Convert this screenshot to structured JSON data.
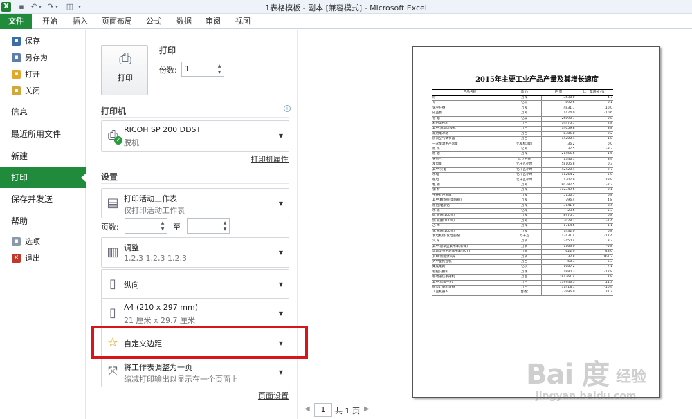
{
  "window": {
    "title": "1表格模板 - 副本  [兼容模式]  -  Microsoft Excel"
  },
  "qat": {
    "logo_glyph": "X",
    "save_glyph": "▪",
    "undo_glyph": "↶",
    "redo_glyph": "↷",
    "dropdown_glyph": "▾",
    "preview_glyph": "◫",
    "customize_glyph": "▾"
  },
  "ribbon_tabs": [
    "文件",
    "开始",
    "插入",
    "页面布局",
    "公式",
    "数据",
    "审阅",
    "视图"
  ],
  "backstage_nav": {
    "commands": [
      {
        "label": "保存",
        "icon": "save-icon",
        "glyph": "▪"
      },
      {
        "label": "另存为",
        "icon": "save-as-icon",
        "glyph": "▪"
      },
      {
        "label": "打开",
        "icon": "open-folder-icon",
        "glyph": "▪"
      },
      {
        "label": "关闭",
        "icon": "close-folder-icon",
        "glyph": "▪"
      }
    ],
    "sections": [
      "信息",
      "最近所用文件",
      "新建",
      "打印",
      "保存并发送",
      "帮助"
    ],
    "bottom": [
      {
        "label": "选项",
        "icon": "options-icon",
        "glyph": "▪"
      },
      {
        "label": "退出",
        "icon": "exit-icon",
        "glyph": "✕"
      }
    ],
    "active": "打印"
  },
  "print": {
    "button_label": "打印",
    "header": "打印",
    "copies_label": "份数:",
    "copies_value": "1",
    "printer_section": "打印机",
    "printer_name": "RICOH SP 200 DDST",
    "printer_status": "脱机",
    "printer_properties": "打印机属性",
    "settings_section": "设置",
    "scope_title": "打印活动工作表",
    "scope_sub": "仅打印活动工作表",
    "pages_label": "页数:",
    "pages_to": "至",
    "collate_title": "调整",
    "collate_sub": "1,2,3    1,2,3    1,2,3",
    "orientation": "纵向",
    "paper_title": "A4 (210 x 297 mm)",
    "paper_sub": "21 厘米 x 29.7 厘米",
    "margins": "自定义边距",
    "scale_title": "将工作表调整为一页",
    "scale_sub": "缩减打印输出以显示在一个页面上",
    "page_setup": "页面设置",
    "info_glyph": "i",
    "spin_up": "▲",
    "spin_down": "▼",
    "caret": "▼",
    "check_glyph": "✓"
  },
  "preview": {
    "title": "2015年主要工业产品产量及其增长速度",
    "columns": [
      "产品名称",
      "单 位",
      "产 量",
      "比上年增长 (%)"
    ],
    "rows": [
      [
        "纱",
        "万吨",
        "3538.0",
        "4.7"
      ],
      [
        "布",
        "亿米",
        "892.6",
        "-0.1"
      ],
      [
        "化学纤维",
        "万吨",
        "4831.7",
        "10.0"
      ],
      [
        "成品糖",
        "万吨",
        "1474.0",
        "-10.6"
      ],
      [
        "卷 烟",
        "亿支",
        "25890.7",
        "-0.8"
      ],
      [
        "彩色电视机",
        "万台",
        "14475.7",
        "2.8"
      ],
      [
        "  其中:液晶电视机",
        "万台",
        "14059.8",
        "3.8"
      ],
      [
        "家用电冰箱",
        "万台",
        "8385.8",
        "-9.2"
      ],
      [
        "房间空气调节器",
        "万台",
        "14200.4",
        "-1.8"
      ],
      [
        "一次能源生产总量",
        "亿吨标准煤",
        "36.2",
        "0.0"
      ],
      [
        "原 煤",
        "亿吨",
        "37.5",
        "-3.3"
      ],
      [
        "原 油",
        "万吨",
        "21455.6",
        "1.5"
      ],
      [
        "天然气",
        "亿立方米",
        "1346.1",
        "3.4"
      ],
      [
        "发电量",
        "亿千瓦小时",
        "58105.8",
        "0.3"
      ],
      [
        "  其中:火电",
        "亿千瓦小时",
        "42420.4",
        "-2.7"
      ],
      [
        "    水电",
        "亿千瓦小时",
        "11264.2",
        "5.0"
      ],
      [
        "    核电",
        "亿千瓦小时",
        "1707.9",
        "28.9"
      ],
      [
        "粗 钢",
        "万吨",
        "80382.5",
        "-2.2"
      ],
      [
        "钢 材",
        "万吨",
        "112349.6",
        "0.1"
      ],
      [
        "十种有色金属",
        "万吨",
        "5156.5",
        "6.8"
      ],
      [
        "  其中:精炼铜(电解铜)",
        "万吨",
        "796.4",
        "4.8"
      ],
      [
        "  原铝(电解铝)",
        "万吨",
        "3141.0",
        "8.4"
      ],
      [
        "水 泥",
        "亿吨",
        "23.6",
        "-5.3"
      ],
      [
        "硫 酸(折100%)",
        "万吨",
        "8975.7",
        "0.8"
      ],
      [
        "烧 碱(折100%)",
        "万吨",
        "3028.1",
        "-1.4"
      ],
      [
        "乙 烯",
        "万吨",
        "1714.6",
        "1.1"
      ],
      [
        "化 肥(折100%)",
        "万吨",
        "7432.0",
        "0.8"
      ],
      [
        "发电机组(发电设备)",
        "万千瓦",
        "12431.4",
        "-17.4"
      ],
      [
        "汽 车",
        "万辆",
        "2450.4",
        "3.3"
      ],
      [
        "其中:基本型乘用车(轿车)",
        "万辆",
        "1163.0",
        "-5.8"
      ],
      [
        "  运动型多用途乘用车(SUV)",
        "万辆",
        "622.0",
        "48.0"
      ],
      [
        "其中:新能源汽车",
        "万辆",
        "32.8",
        "161.2"
      ],
      [
        "大中型拖拉机",
        "万台",
        "58.3",
        "6.3"
      ],
      [
        "集成电路",
        "亿块",
        "1087.2",
        "7.1"
      ],
      [
        "程控交换机",
        "万线",
        "1880.3",
        "-12.8"
      ],
      [
        "移动通信手持机",
        "万台",
        "181261.4",
        "7.8"
      ],
      [
        "  其中:智能手机",
        "万台",
        "139943.3",
        "11.3"
      ],
      [
        "微型计算机设备",
        "万台",
        "31418.7",
        "-10.4"
      ],
      [
        "工业机器人",
        "台/套",
        "32996.0",
        "21.7"
      ]
    ]
  },
  "pager": {
    "prev": "◀",
    "current": "1",
    "total": "共 1 页",
    "next": "▶"
  },
  "watermark": {
    "logo": "Bai 度",
    "text": "经验",
    "url": "jingyan.baidu.com"
  }
}
